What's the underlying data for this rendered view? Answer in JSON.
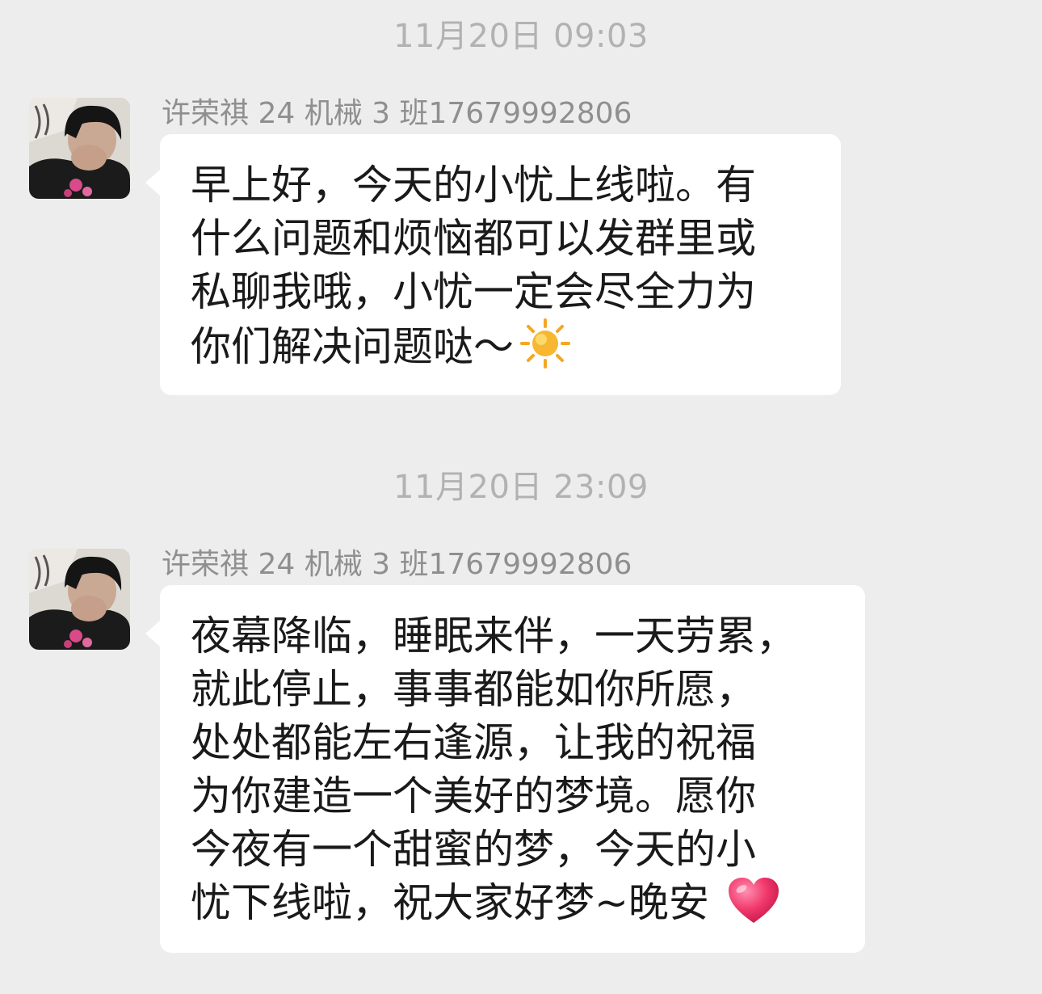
{
  "chat": {
    "messages": [
      {
        "timestamp": "11月20日 09:03",
        "sender": "许荣祺 24 机械 3 班17679992806",
        "lines": [
          "早上好，今天的小忧上线啦。有",
          "什么问题和烦恼都可以发群里或",
          "私聊我哦，小忧一定会尽全力为",
          "你们解决问题哒～"
        ],
        "emoji": "sun-emoji"
      },
      {
        "timestamp": "11月20日 23:09",
        "sender": "许荣祺 24 机械 3 班17679992806",
        "lines": [
          "夜幕降临，睡眠来伴，一天劳累，",
          "就此停止，事事都能如你所愿，",
          "处处都能左右逢源，让我的祝福",
          "为你建造一个美好的梦境。愿你",
          "今夜有一个甜蜜的梦，今天的小",
          "忧下线啦，祝大家好梦~晚安"
        ],
        "emoji": "red-heart-emoji"
      }
    ]
  },
  "colors": {
    "background": "#ededed",
    "bubble": "#ffffff",
    "timestamp_text": "#b2b2b2",
    "sender_text": "#8f8f8f",
    "message_text": "#1a1a1a"
  }
}
